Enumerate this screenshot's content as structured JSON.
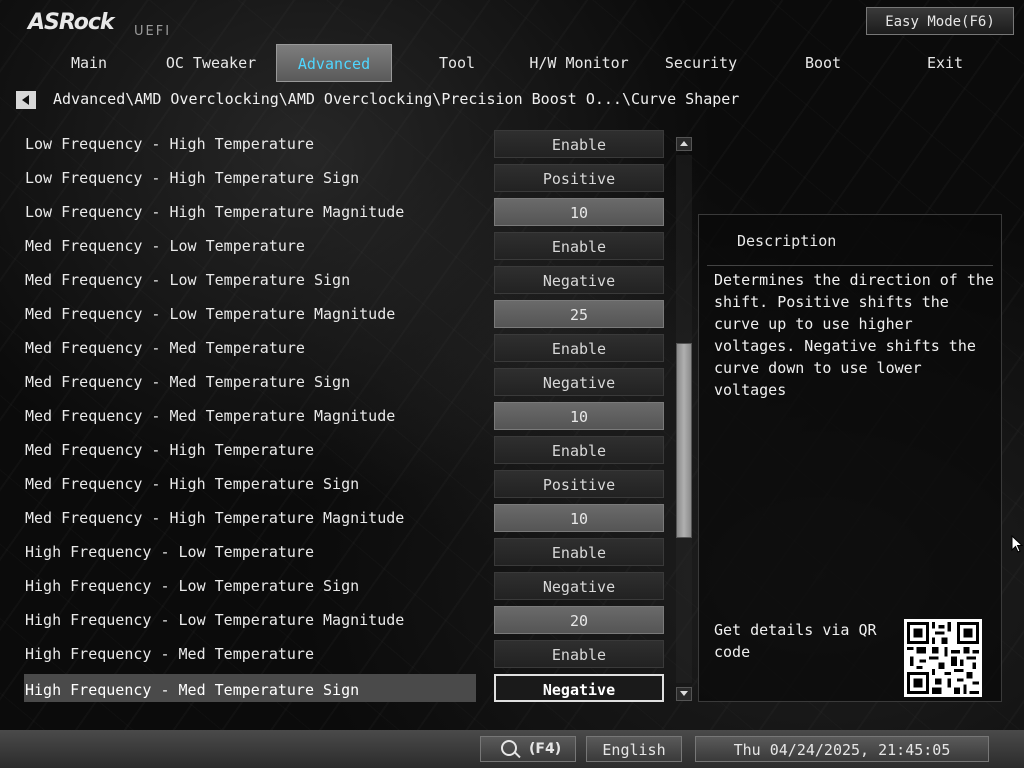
{
  "logo": {
    "brand": "ASRock",
    "product": "UEFI"
  },
  "easy_mode_label": "Easy Mode(F6)",
  "tabs": [
    {
      "label": "Main",
      "active": false
    },
    {
      "label": "OC Tweaker",
      "active": false
    },
    {
      "label": "Advanced",
      "active": true
    },
    {
      "label": "Tool",
      "active": false
    },
    {
      "label": "H/W Monitor",
      "active": false
    },
    {
      "label": "Security",
      "active": false
    },
    {
      "label": "Boot",
      "active": false
    },
    {
      "label": "Exit",
      "active": false
    }
  ],
  "breadcrumb": "Advanced\\AMD Overclocking\\AMD Overclocking\\Precision Boost O...\\Curve Shaper",
  "settings": [
    {
      "label": "Low Frequency - High Temperature",
      "value": "Enable",
      "kind": "option"
    },
    {
      "label": "Low Frequency - High Temperature Sign",
      "value": "Positive",
      "kind": "option"
    },
    {
      "label": "Low Frequency - High Temperature Magnitude",
      "value": "10",
      "kind": "number"
    },
    {
      "label": "Med Frequency - Low Temperature",
      "value": "Enable",
      "kind": "option"
    },
    {
      "label": "Med Frequency - Low Temperature Sign",
      "value": "Negative",
      "kind": "option"
    },
    {
      "label": "Med Frequency - Low Temperature Magnitude",
      "value": "25",
      "kind": "number"
    },
    {
      "label": "Med Frequency - Med Temperature",
      "value": "Enable",
      "kind": "option"
    },
    {
      "label": "Med Frequency - Med Temperature Sign",
      "value": "Negative",
      "kind": "option"
    },
    {
      "label": "Med Frequency - Med Temperature Magnitude",
      "value": "10",
      "kind": "number"
    },
    {
      "label": "Med Frequency - High Temperature",
      "value": "Enable",
      "kind": "option"
    },
    {
      "label": "Med Frequency - High Temperature Sign",
      "value": "Positive",
      "kind": "option"
    },
    {
      "label": "Med Frequency - High Temperature Magnitude",
      "value": "10",
      "kind": "number"
    },
    {
      "label": "High Frequency - Low Temperature",
      "value": "Enable",
      "kind": "option"
    },
    {
      "label": "High Frequency - Low Temperature Sign",
      "value": "Negative",
      "kind": "option"
    },
    {
      "label": "High Frequency - Low Temperature Magnitude",
      "value": "20",
      "kind": "number"
    },
    {
      "label": "High Frequency - Med Temperature",
      "value": "Enable",
      "kind": "option"
    },
    {
      "label": "High Frequency - Med Temperature Sign",
      "value": "Negative",
      "kind": "option",
      "selected": true
    }
  ],
  "description": {
    "title": "Description",
    "text": "Determines the direction of the shift. Positive shifts the curve up to use higher voltages. Negative shifts the curve down to use lower voltages",
    "qr_text": "Get details via QR code"
  },
  "footer": {
    "search_key": "(F4)",
    "language": "English",
    "datetime": "Thu 04/24/2025, 21:45:05"
  },
  "colors": {
    "accent_tab_text": "#4fd6ff",
    "background": "#0b0b0b"
  }
}
